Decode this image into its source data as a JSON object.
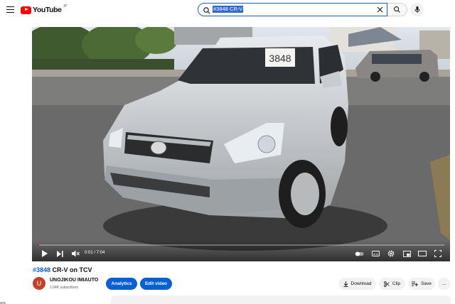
{
  "header": {
    "logo_text": "YouTube",
    "logo_sup": "JP",
    "search_value": "#3848 CR-V",
    "icons": {
      "menu": "hamburger-menu-icon",
      "search": "search-icon",
      "clear": "close-icon",
      "mic": "microphone-icon"
    }
  },
  "player": {
    "plate": "3848",
    "current_time": "0:01",
    "time_display": "0:01 / 7:04",
    "progress_fraction": 0.004,
    "accent_color": "#ff0000",
    "icons": [
      "play-icon",
      "next-icon",
      "mute-icon",
      "autoplay-toggle-icon",
      "subtitles-icon",
      "settings-icon",
      "miniplayer-icon",
      "theater-mode-icon",
      "fullscreen-icon"
    ]
  },
  "video": {
    "title_tag": "#3848",
    "title_rest": " CR-V on TCV",
    "channel_name": "UNOJIKOU IMIAUTO",
    "channel_initial": "U",
    "subscribers": "1.04K subscribers"
  },
  "actions": {
    "analytics": "Analytics",
    "edit_video": "Edit video",
    "download": "Download",
    "clip": "Clip",
    "save": "Save",
    "more": "..."
  },
  "colors": {
    "brand_red": "#ff0000",
    "link_blue": "#065fd4",
    "search_border": "#1c62b9"
  }
}
